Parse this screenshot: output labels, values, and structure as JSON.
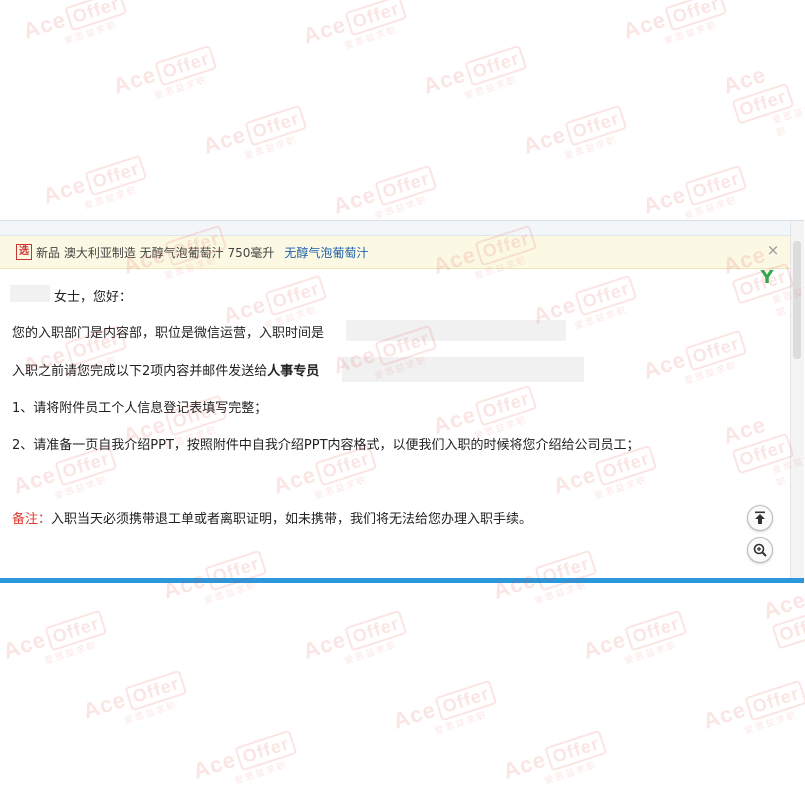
{
  "ad_bar": {
    "icon_text": "选",
    "text": "新品 澳大利亚制造 无醇气泡葡萄汁 750毫升",
    "link_text": "无醇气泡葡萄汁",
    "close_symbol": "×"
  },
  "badge": {
    "text": "Y",
    "color": "#2ea84a"
  },
  "email": {
    "greeting": "女士，您好：",
    "line1": "您的入职部门是内容部，职位是微信运营，入职时间是",
    "line2_pre": "入职之前请您完成以下2项内容并邮件发送给",
    "line2_bold": "人事专员",
    "item1": "1、请将附件员工个人信息登记表填写完整；",
    "item2": "2、请准备一页自我介绍PPT，按照附件中自我介绍PPT内容格式，以便我们入职的时候将您介绍给公司员工；",
    "note_label": "备注：",
    "note_text": "入职当天必须携带退工单或者离职证明，如未携带，我们将无法给您办理入职手续。"
  },
  "watermark": {
    "brand": "Ace",
    "brand_box": "Offer",
    "sub": "爱思益求职"
  },
  "icons": {
    "scroll_top": "arrow-up-to-top-icon",
    "zoom": "zoom-in-icon",
    "ad": "ad-tag-icon"
  },
  "colors": {
    "accent_blue": "#2d97db",
    "note_red": "#e03a2e",
    "link_blue": "#1f5fa8"
  }
}
